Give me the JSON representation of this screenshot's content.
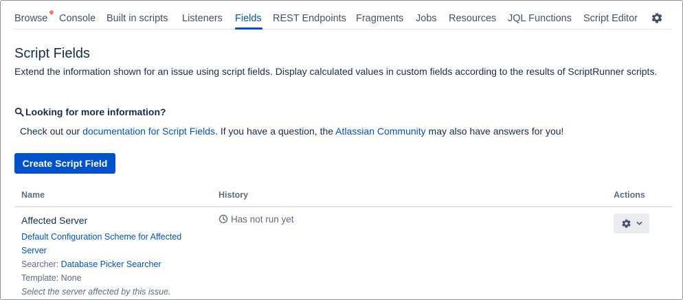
{
  "nav": {
    "items": [
      {
        "label": "Browse",
        "name": "nav-browse"
      },
      {
        "label": "Console",
        "name": "nav-console"
      },
      {
        "label": "Built in scripts",
        "name": "nav-built-in-scripts"
      },
      {
        "label": "Listeners",
        "name": "nav-listeners"
      },
      {
        "label": "Fields",
        "name": "nav-fields"
      },
      {
        "label": "REST Endpoints",
        "name": "nav-rest-endpoints"
      },
      {
        "label": "Fragments",
        "name": "nav-fragments"
      },
      {
        "label": "Jobs",
        "name": "nav-jobs"
      },
      {
        "label": "Resources",
        "name": "nav-resources"
      },
      {
        "label": "JQL Functions",
        "name": "nav-jql-functions"
      },
      {
        "label": "Script Editor",
        "name": "nav-script-editor"
      }
    ],
    "active": "Fields",
    "settings_icon": "gear-icon",
    "notification_dot_color": "#ff7452"
  },
  "page": {
    "title": "Script Fields",
    "description": "Extend the information shown for an issue using script fields. Display calculated values in custom fields according to the results of ScriptRunner scripts."
  },
  "info": {
    "heading": "Looking for more information?",
    "icon": "search-icon",
    "text_before": "Check out our ",
    "doc_link": "documentation for Script Fields",
    "text_middle": ". If you have a question, the ",
    "community_link": "Atlassian Community",
    "text_after": " may also have answers for you!"
  },
  "create_button": "Create Script Field",
  "table": {
    "columns": {
      "name": "Name",
      "history": "History",
      "actions": "Actions"
    },
    "rows": [
      {
        "name": "Affected Server",
        "config_link": "Default Configuration Scheme for Affected Server",
        "searcher_label": "Searcher: ",
        "searcher_link": "Database Picker Searcher",
        "template": "Template: None",
        "description": "Select the server affected by this issue.",
        "history": "Has not run yet",
        "history_icon": "clock-icon",
        "action_icon": "gear-icon"
      }
    ]
  },
  "colors": {
    "primary": "#0052cc",
    "text": "#172b4d",
    "subtle": "#5e6c84",
    "nav_text": "#42526e"
  }
}
